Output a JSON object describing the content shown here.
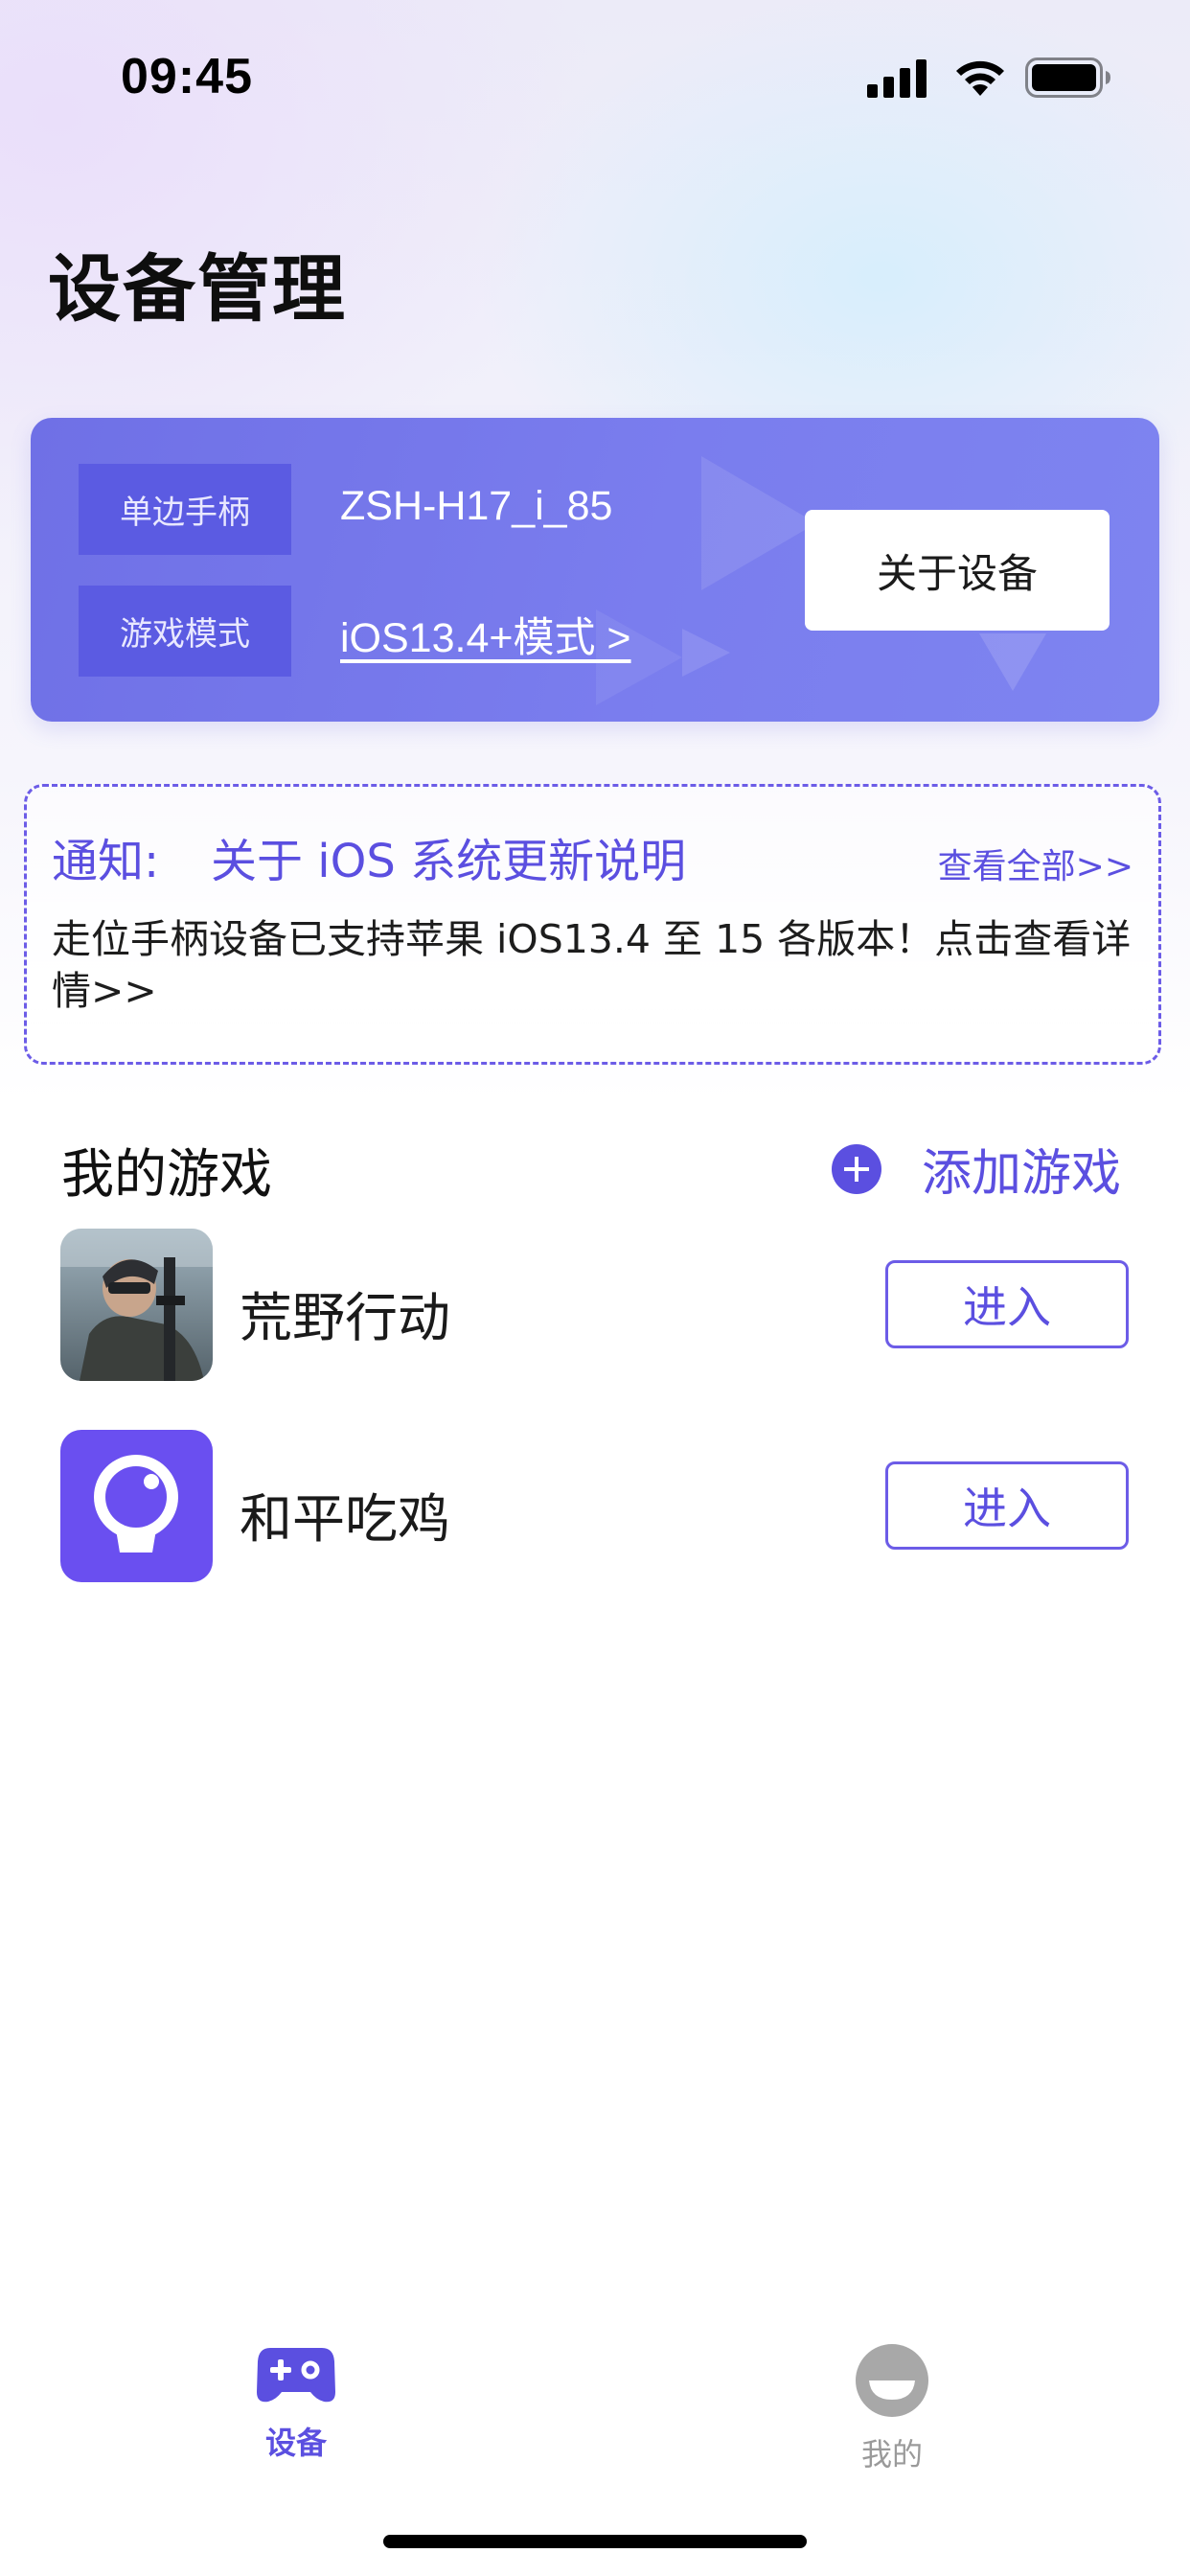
{
  "status_bar": {
    "time": "09:45"
  },
  "page": {
    "title": "设备管理"
  },
  "device_card": {
    "handle_label": "单边手柄",
    "device_name": "ZSH-H17_i_85",
    "mode_label": "游戏模式",
    "mode_value": "iOS13.4+模式 >",
    "about_button": "关于设备"
  },
  "notice": {
    "prefix": "通知:",
    "title": "关于 iOS 系统更新说明",
    "view_all": "查看全部>>",
    "body": "走位手柄设备已支持苹果 iOS13.4 至 15 各版本！点击查看详情>>"
  },
  "games": {
    "section_title": "我的游戏",
    "add_label": "添加游戏",
    "items": [
      {
        "name": "荒野行动",
        "enter_label": "进入"
      },
      {
        "name": "和平吃鸡",
        "enter_label": "进入"
      }
    ]
  },
  "tab_bar": {
    "items": [
      {
        "label": "设备",
        "active": true
      },
      {
        "label": "我的",
        "active": false
      }
    ]
  },
  "colors": {
    "accent": "#5b4fe0",
    "card_bg": "#7479ec",
    "card_label_bg": "#5b5be2"
  },
  "icons": {
    "signal": "signal-bars-icon",
    "wifi": "wifi-icon",
    "battery": "battery-icon",
    "add": "plus-circle-icon",
    "tab_device": "gamepad-icon",
    "tab_mine": "profile-face-icon"
  }
}
